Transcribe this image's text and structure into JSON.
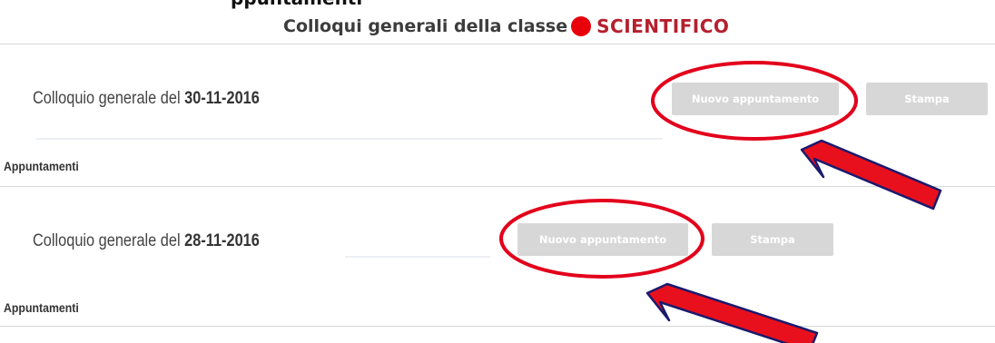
{
  "page": {
    "top_clipped_text": "ppuntamenti",
    "heading": {
      "prefix": "Colloqui generali della classe",
      "class_name": "SCIENTIFICO"
    }
  },
  "colloqui": [
    {
      "title_prefix": "Colloquio generale del",
      "date": "30-11-2016",
      "new_appointment_label": "Nuovo appuntamento",
      "print_label": "Stampa",
      "appointments_label": "Appuntamenti"
    },
    {
      "title_prefix": "Colloquio generale del",
      "date": "28-11-2016",
      "new_appointment_label": "Nuovo appuntamento",
      "print_label": "Stampa",
      "appointments_label": "Appuntamenti"
    }
  ],
  "annotations": {
    "highlight_color": "#e3001b",
    "arrow_fill": "#e8101d",
    "arrow_outline": "#1a1a6e"
  },
  "colors": {
    "button_disabled": "#d7d7d7",
    "class_name": "#b5202e",
    "divider": "#d6d6d6"
  }
}
